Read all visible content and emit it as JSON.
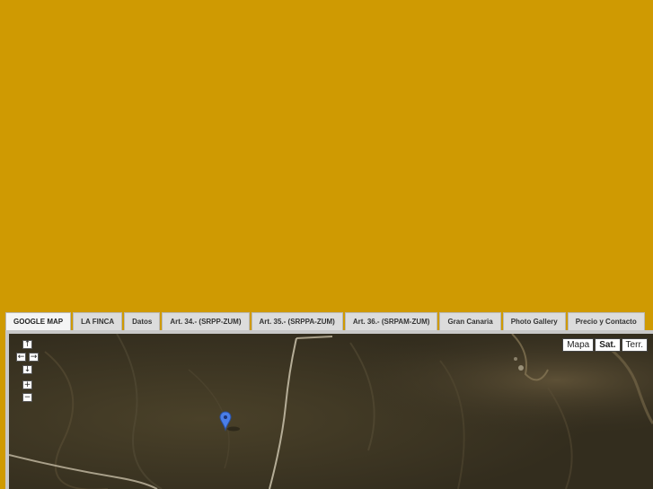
{
  "tabs": [
    {
      "label": "GOOGLE MAP",
      "active": true
    },
    {
      "label": "LA FINCA"
    },
    {
      "label": "Datos"
    },
    {
      "label": "Art. 34.- (SRPP-ZUM)"
    },
    {
      "label": "Art. 35.- (SRPPA-ZUM)"
    },
    {
      "label": "Art. 36.- (SRPAM-ZUM)"
    },
    {
      "label": "Gran Canaria"
    },
    {
      "label": "Photo Gallery"
    },
    {
      "label": "Precio y Contacto"
    }
  ],
  "map": {
    "controls": {
      "up": "↑",
      "left": "←",
      "right": "→",
      "down": "↓",
      "zoom_in": "+",
      "zoom_out": "−"
    },
    "types": [
      {
        "label": "Mapa"
      },
      {
        "label": "Sat.",
        "active": true
      },
      {
        "label": "Terr."
      }
    ],
    "marker_color": "#4a7ee8"
  },
  "colors": {
    "background": "#cf9a02"
  }
}
